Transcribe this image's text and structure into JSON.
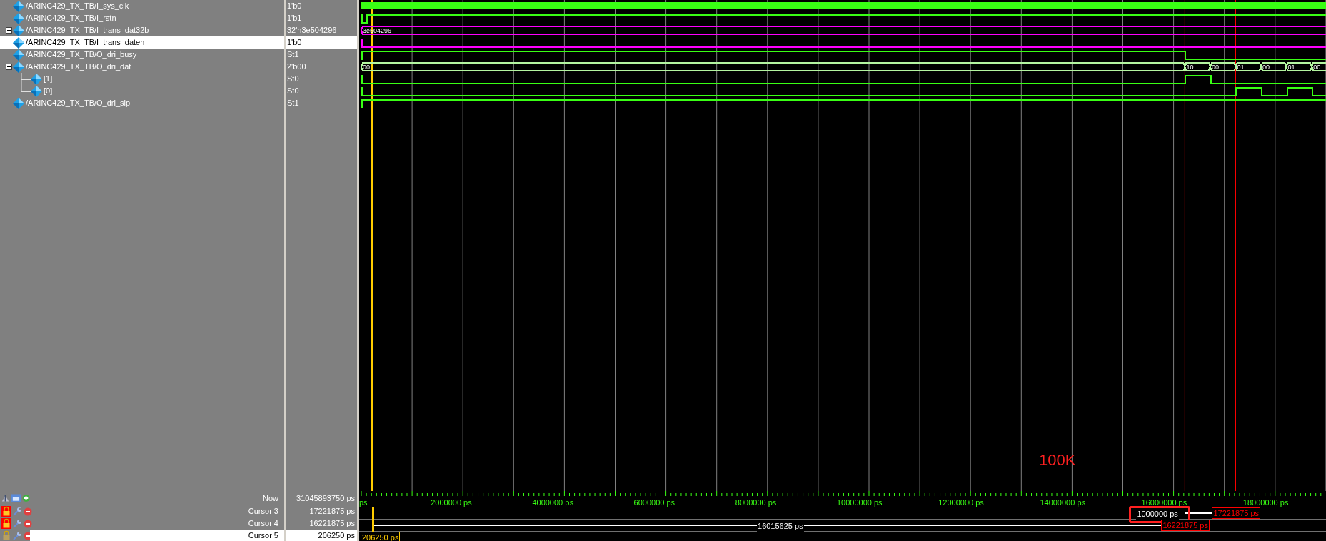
{
  "signals": [
    {
      "name": "/ARINC429_TX_TB/I_sys_clk",
      "value": "1'b0",
      "selected": false,
      "wave": {
        "kind": "clock",
        "color": "#39ff14"
      }
    },
    {
      "name": "/ARINC429_TX_TB/I_rstn",
      "value": "1'b1",
      "selected": false,
      "wave": {
        "kind": "bit",
        "color": "#39ff14",
        "segments": [
          {
            "high": false
          },
          {
            "high": true
          }
        ]
      }
    },
    {
      "name": "/ARINC429_TX_TB/I_trans_dat32b",
      "value": "32'h3e504296",
      "selected": false,
      "expanded": false,
      "wave": {
        "kind": "bus",
        "color": "#ff00ff",
        "segments": [
          {
            "label": "3e504296"
          }
        ]
      }
    },
    {
      "name": "/ARINC429_TX_TB/I_trans_daten",
      "value": "1'b0",
      "selected": true,
      "wave": {
        "kind": "bit",
        "color": "#ff00ff",
        "segments": [
          {
            "high": false
          }
        ]
      }
    },
    {
      "name": "/ARINC429_TX_TB/O_dri_busy",
      "value": "St1",
      "selected": false,
      "wave": {
        "kind": "bit",
        "color": "#39ff14",
        "segments": [
          {
            "high": true
          },
          {
            "high": false
          }
        ]
      }
    },
    {
      "name": "/ARINC429_TX_TB/O_dri_dat",
      "value": "2'b00",
      "selected": false,
      "expanded": true,
      "wave": {
        "kind": "bus",
        "color": "#b4f5a0",
        "segments": [
          {
            "label": "00"
          },
          {
            "label": "10"
          },
          {
            "label": "00"
          },
          {
            "label": "01"
          },
          {
            "label": "00"
          },
          {
            "label": "01"
          },
          {
            "label": "00"
          }
        ]
      },
      "children": [
        {
          "name": "[1]",
          "value": "St0",
          "selected": false,
          "wave": {
            "kind": "bit",
            "color": "#39ff14",
            "segments": [
              {
                "high": false
              },
              {
                "high": true
              },
              {
                "high": false
              }
            ]
          }
        },
        {
          "name": "[0]",
          "value": "St0",
          "selected": false,
          "wave": {
            "kind": "bit",
            "color": "#39ff14",
            "segments": [
              {
                "high": false
              },
              {
                "high": true
              },
              {
                "high": false
              },
              {
                "high": true
              },
              {
                "high": false
              }
            ]
          }
        }
      ]
    },
    {
      "name": "/ARINC429_TX_TB/O_dri_slp",
      "value": "St1",
      "selected": false,
      "wave": {
        "kind": "bit",
        "color": "#39ff14",
        "segments": [
          {
            "high": true
          }
        ]
      }
    }
  ],
  "annotation": {
    "text": "100K"
  },
  "time_axis": {
    "ticks": [
      "ps",
      "2000000 ps",
      "4000000 ps",
      "6000000 ps",
      "8000000 ps",
      "10000000 ps",
      "12000000 ps",
      "14000000 ps",
      "16000000 ps",
      "18000000 ps"
    ]
  },
  "cursors": [
    {
      "kind": "now",
      "label": "Now",
      "value": "31045893750 ps"
    },
    {
      "kind": "cursor",
      "label": "Cursor 3",
      "value": "17221875 ps",
      "locked": true,
      "selected": false,
      "delta": "1000000 ps",
      "highlighted": true,
      "tag": "17221875 ps"
    },
    {
      "kind": "cursor",
      "label": "Cursor 4",
      "value": "16221875 ps",
      "locked": true,
      "selected": false,
      "delta": "16015625 ps",
      "highlighted": false,
      "tag": "16221875 ps"
    },
    {
      "kind": "cursor",
      "label": "Cursor 5",
      "value": "206250 ps",
      "locked": false,
      "selected": true,
      "tag": "206250 ps"
    }
  ]
}
